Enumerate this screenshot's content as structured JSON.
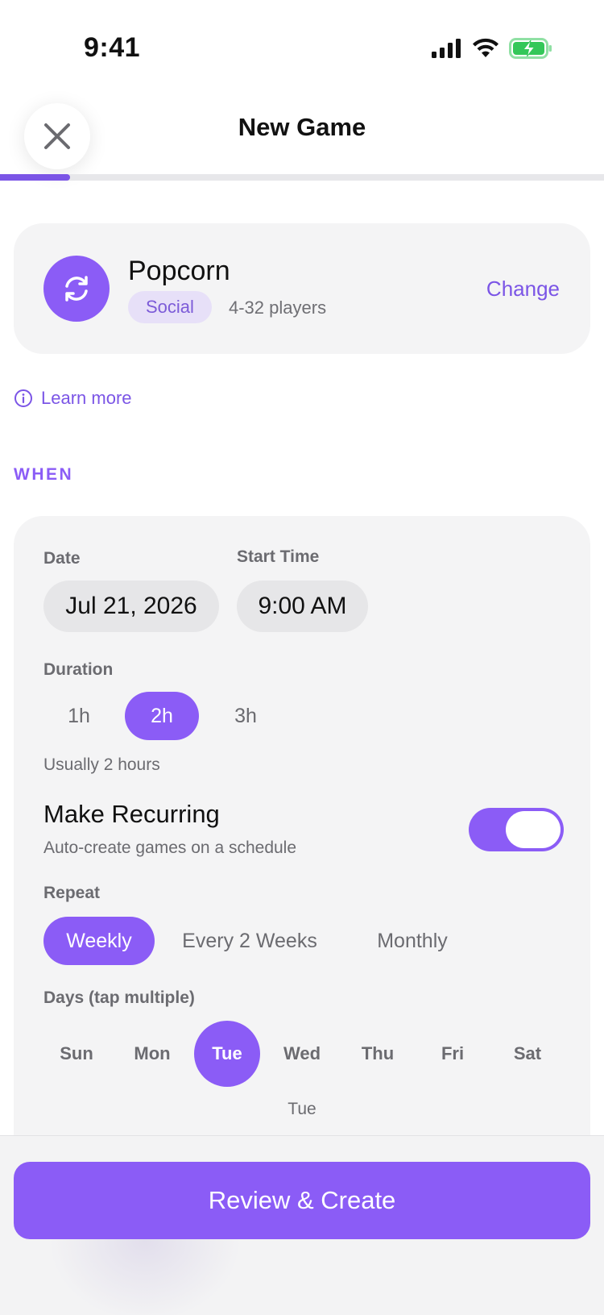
{
  "status_bar": {
    "time": "9:41"
  },
  "header": {
    "title": "New Game"
  },
  "progress": {
    "fraction": 0.116
  },
  "game": {
    "name": "Popcorn",
    "badge": "Social",
    "players": "4-32 players",
    "change_label": "Change",
    "icon": "refresh-icon"
  },
  "learn_more": "Learn more",
  "when": {
    "section_label": "WHEN",
    "date_label": "Date",
    "date_value": "Jul 21, 2026",
    "start_time_label": "Start Time",
    "start_time_value": "9:00 AM",
    "duration_label": "Duration",
    "durations": [
      "1h",
      "2h",
      "3h"
    ],
    "selected_duration": "2h",
    "duration_hint": "Usually 2 hours",
    "recurring_title": "Make Recurring",
    "recurring_sub": "Auto-create games on a schedule",
    "recurring_on": true,
    "repeat_label": "Repeat",
    "repeat_options": [
      "Weekly",
      "Every 2 Weeks",
      "Monthly"
    ],
    "selected_repeat": "Weekly",
    "days_label": "Days (tap multiple)",
    "days": [
      "Sun",
      "Mon",
      "Tue",
      "Wed",
      "Thu",
      "Fri",
      "Sat"
    ],
    "selected_days": [
      "Tue"
    ],
    "days_summary": "Tue"
  },
  "cta_label": "Review & Create",
  "colors": {
    "accent": "#8b5cf6",
    "accent_dark": "#7b55e6",
    "card_bg": "#f4f4f5"
  }
}
